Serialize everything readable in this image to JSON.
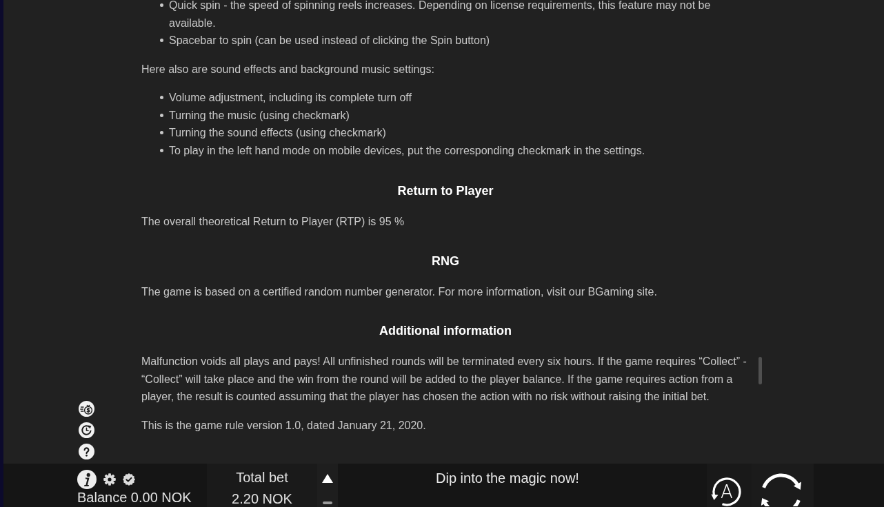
{
  "rules": [
    {
      "kind": "list",
      "items": [
        "Quick spin - the speed of spinning reels increases. Depending on license requirements, this feature may not be available.",
        "Spacebar to spin (can be used instead of clicking the Spin button)"
      ]
    },
    {
      "kind": "paragraph",
      "text": "Here also are sound effects and background music settings:"
    },
    {
      "kind": "list",
      "items": [
        "Volume adjustment, including its complete turn off",
        "Turning the music (using checkmark)",
        "Turning the sound effects (using checkmark)",
        "To play in the left hand mode on mobile devices, put the corresponding checkmark in the settings."
      ]
    },
    {
      "kind": "heading",
      "text": "Return to Player"
    },
    {
      "kind": "paragraph",
      "text": "The overall theoretical Return to Player (RTP) is 95 %"
    },
    {
      "kind": "heading",
      "text": "RNG"
    },
    {
      "kind": "paragraph",
      "text": "The game is based on a certified random number generator. For more information, visit our BGaming site."
    },
    {
      "kind": "heading",
      "text": "Additional information"
    },
    {
      "kind": "paragraph",
      "text": "Malfunction voids all plays and pays! All unfinished rounds will be terminated every six hours. If the game requires “Collect” - “Collect” will take place and the win from the round will be added to the player balance. If the game requires action from a player, the result is counted assuming that the player has chosen the action with no risk without raising the initial bet."
    },
    {
      "kind": "paragraph",
      "text": "This is the game rule version 1.0, dated January 21, 2020."
    }
  ],
  "bottom_bar": {
    "balance": "Balance 0.00 NOK",
    "total_bet_label": "Total bet",
    "total_bet": "2.20 NOK",
    "message": "Dip into the magic now!",
    "autoplay_label": "A"
  }
}
